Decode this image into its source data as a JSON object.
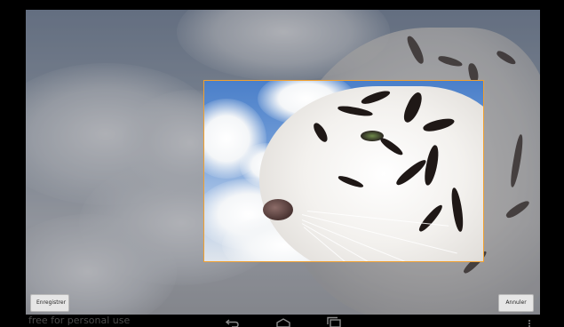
{
  "buttons": {
    "save_label": "Enregistrer",
    "cancel_label": "Annuler"
  },
  "watermark": "free for personal use",
  "navigation": {
    "icons": [
      "back-icon",
      "home-icon",
      "recents-icon",
      "overflow-menu-icon"
    ]
  },
  "colors": {
    "crop_border": "#f0a030",
    "sky_blue": "#4a7fc9",
    "button_bg": "#e6e6e6"
  }
}
